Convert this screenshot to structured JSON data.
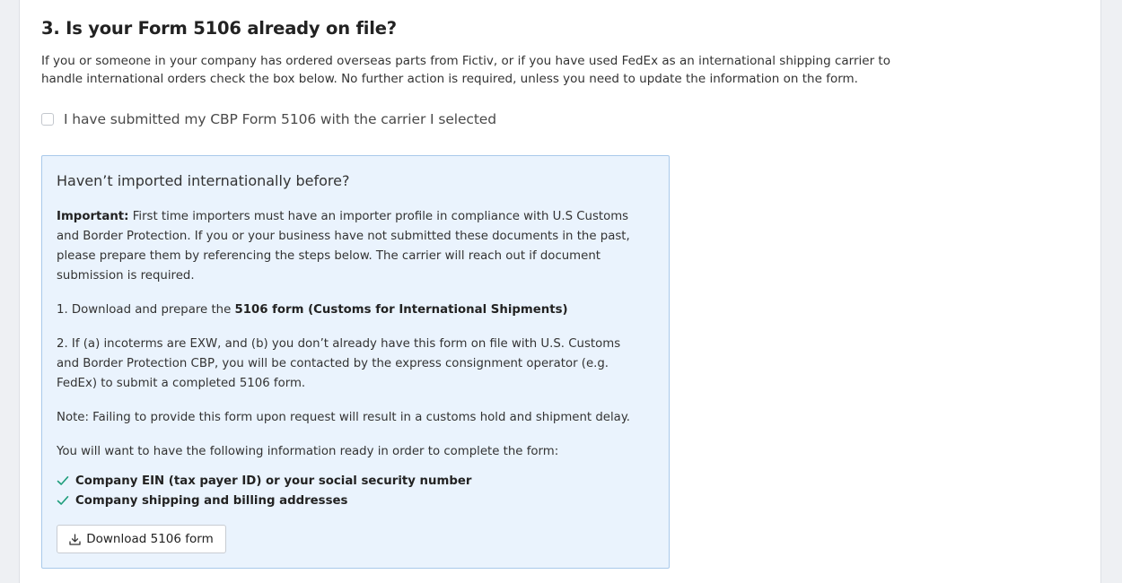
{
  "section": {
    "title": "3. Is your Form 5106 already on file?",
    "intro": "If you or someone in your company has ordered overseas parts from Fictiv, or if you have used FedEx as an international shipping carrier to handle international orders check the box below. No further action is required, unless you need to update the information on the form.",
    "checkbox_label": "I have submitted my CBP Form 5106 with the carrier I selected",
    "checkbox_checked": false
  },
  "infobox": {
    "title": "Haven’t imported internationally before?",
    "important_label": "Important:",
    "important_text": " First time importers must have an importer profile in compliance with U.S Customs and Border Protection. If you or your business have not submitted these documents in the past, please prepare them by referencing the steps below. The carrier will reach out if document submission is required.",
    "step1_prefix": "1. Download and prepare the ",
    "step1_link": "5106 form (Customs for International Shipments)",
    "step2": "2. If (a) incoterms are EXW, and (b) you don’t already have this form on file with U.S. Customs and Border Protection CBP, you will be contacted by the express consignment operator (e.g. FedEx) to submit a completed 5106 form.",
    "note": "Note: Failing to provide this form upon request will result in a customs hold and shipment delay.",
    "ready_intro": "You will want to have the following information ready in order to complete the form:",
    "checklist": [
      "Company EIN (tax payer ID) or your social security number",
      "Company shipping and billing addresses"
    ],
    "download_label": "Download 5106 form",
    "download_icon": "download-icon",
    "check_icon": "checkmark-icon"
  },
  "colors": {
    "page_background": "#eef0f3",
    "card_background": "#ffffff",
    "infobox_background": "#eaf3fd",
    "infobox_border": "#a9c9ea",
    "check_accent": "#1f9e7c"
  }
}
